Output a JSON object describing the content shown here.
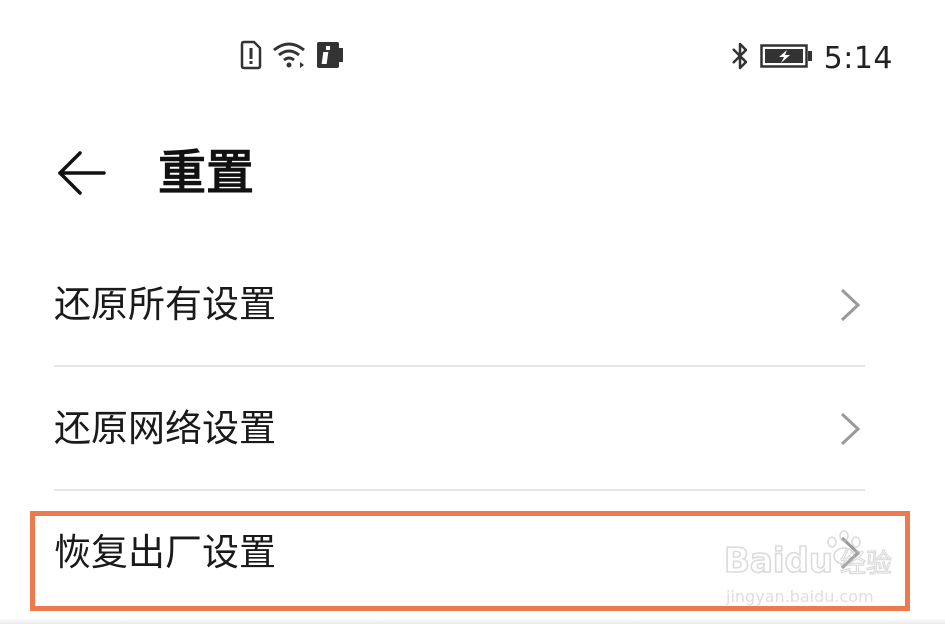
{
  "status_bar": {
    "time": "5:14",
    "left_icons": [
      "sim-alert-icon",
      "wifi-icon",
      "info-app-icon"
    ],
    "right_icons": [
      "bluetooth-icon",
      "battery-charging-icon"
    ]
  },
  "header": {
    "back_icon": "arrow-left-icon",
    "title": "重置"
  },
  "list": {
    "items": [
      {
        "label": "还原所有设置",
        "icon": "chevron-right-icon"
      },
      {
        "label": "还原网络设置",
        "icon": "chevron-right-icon"
      },
      {
        "label": "恢复出厂设置",
        "icon": "chevron-right-icon",
        "highlighted": true
      }
    ]
  },
  "annotation": {
    "highlight_color": "#ec7a4f"
  },
  "watermark": {
    "brand": "Baidu",
    "brand_cn": "经验",
    "url": "jingyan.baidu.com"
  },
  "colors": {
    "background": "#ffffff",
    "text": "#1a1a1a",
    "divider": "#e6e6e6",
    "chevron": "#9a9a9a"
  }
}
